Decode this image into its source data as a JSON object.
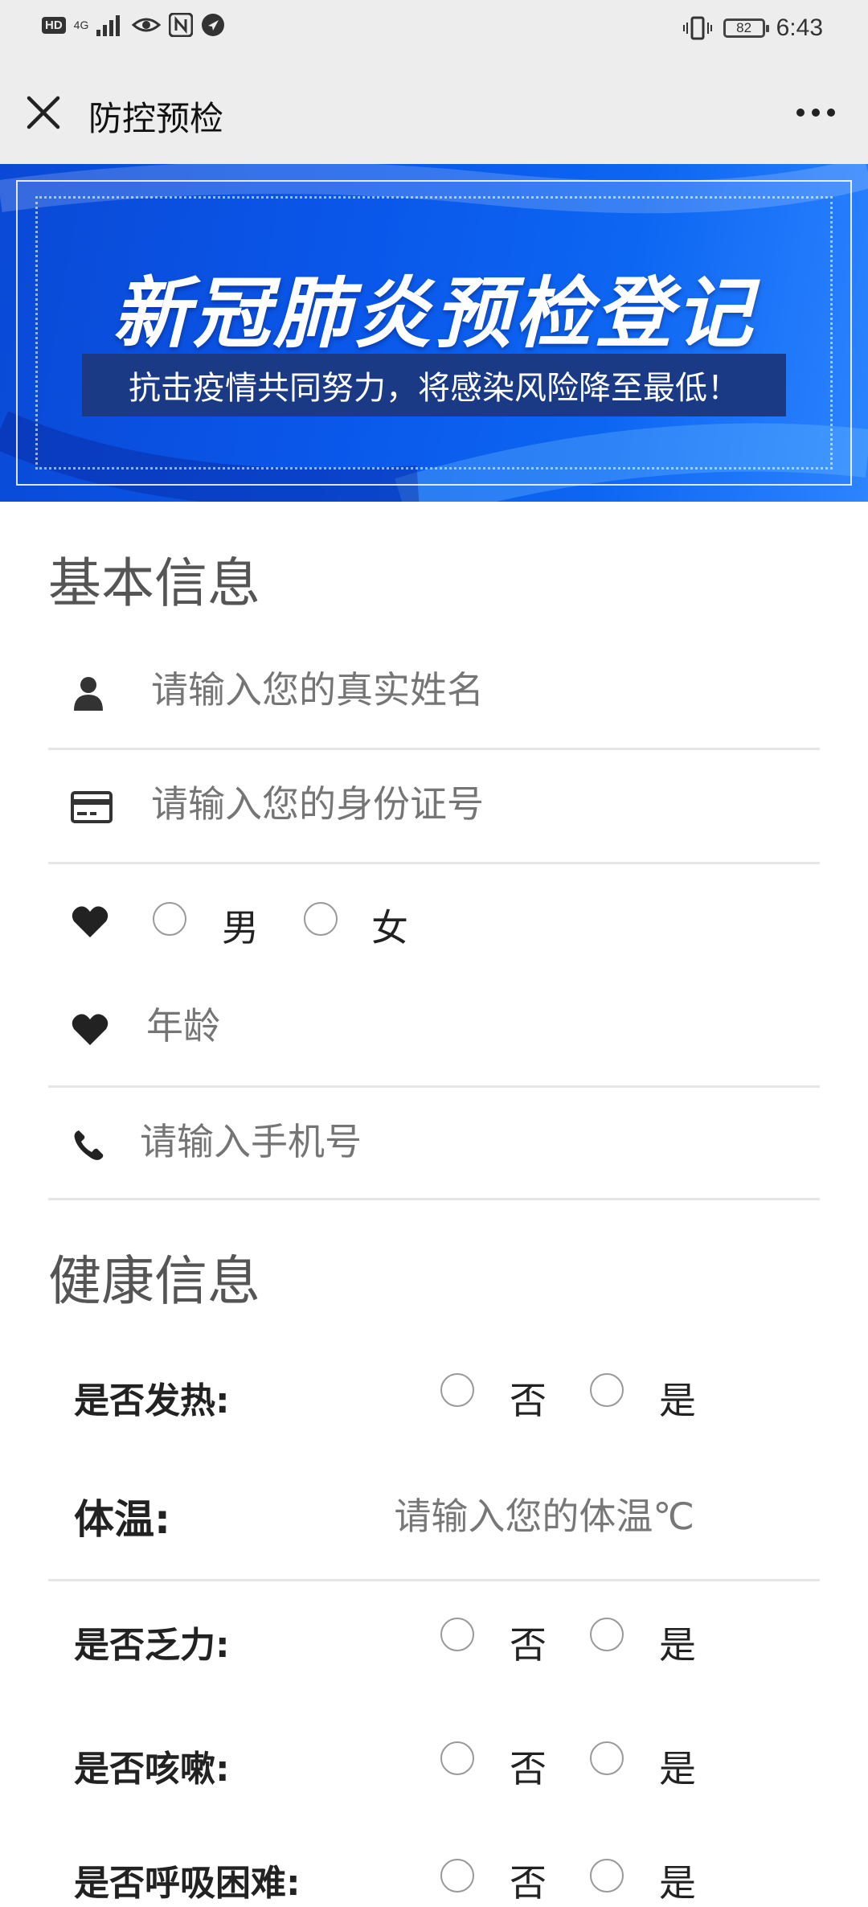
{
  "status_bar": {
    "hd": "HD",
    "network": "4G",
    "battery": "82",
    "time": "6:43"
  },
  "title_bar": {
    "title": "防控预检"
  },
  "banner": {
    "title": "新冠肺炎预检登记",
    "subtitle": "抗击疫情共同努力，将感染风险降至最低！"
  },
  "basic_info": {
    "heading": "基本信息",
    "name_placeholder": "请输入您的真实姓名",
    "id_placeholder": "请输入您的身份证号",
    "gender_male": "男",
    "gender_female": "女",
    "age_placeholder": "年龄",
    "phone_placeholder": "请输入手机号"
  },
  "health_info": {
    "heading": "健康信息",
    "fever_label": "是否发热:",
    "temp_label": "体温:",
    "temp_placeholder": "请输入您的体温℃",
    "fatigue_label": "是否乏力:",
    "cough_label": "是否咳嗽:",
    "breath_label": "是否呼吸困难:",
    "option_no": "否",
    "option_yes": "是"
  }
}
